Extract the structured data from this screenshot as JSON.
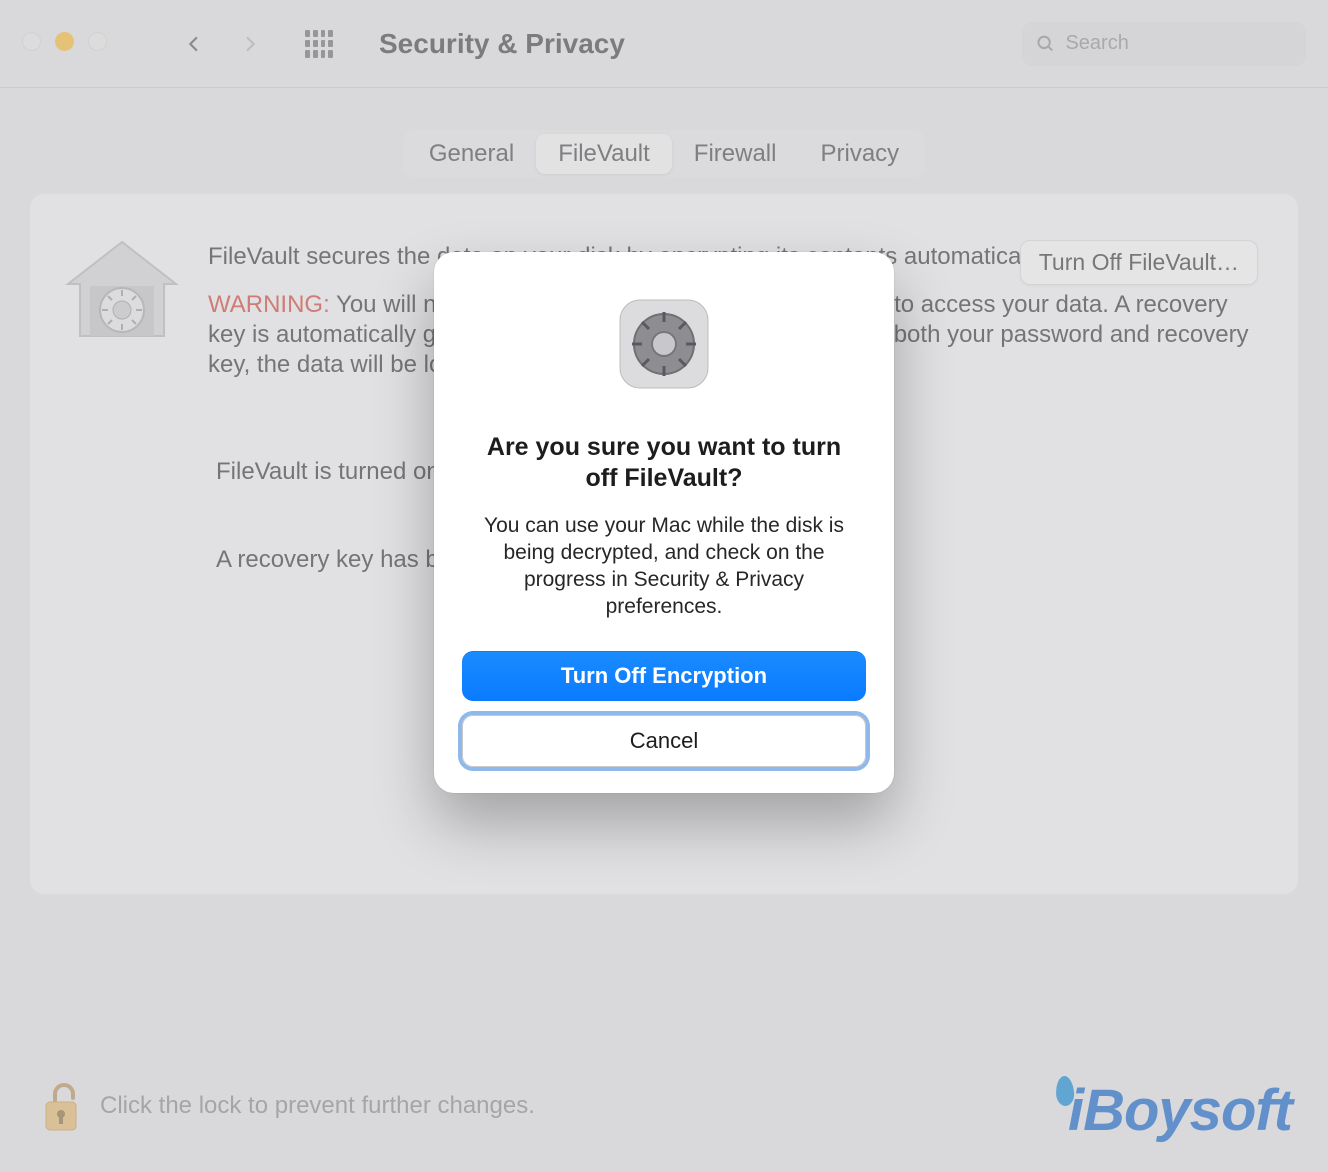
{
  "header": {
    "title": "Security & Privacy",
    "search_placeholder": "Search"
  },
  "tabs": {
    "items": [
      "General",
      "FileVault",
      "Firewall",
      "Privacy"
    ],
    "active_index": 1
  },
  "panel": {
    "description": "FileVault secures the data on your disk by encrypting its contents automatically.",
    "warning_label": "WARNING:",
    "warning_text": "You will need your login password or a recovery key to access your data. A recovery key is automatically generated as part of this setup. If you forget both your password and recovery key, the data will be lost.",
    "turn_off_button": "Turn Off FileVault…",
    "status_line": "FileVault is turned on for the disk \"Macintosh HD\".",
    "recovery_line": "A recovery key has been set."
  },
  "footer": {
    "lock_text": "Click the lock to prevent further changes."
  },
  "modal": {
    "heading": "Are you sure you want to turn off FileVault?",
    "body": "You can use your Mac while the disk is being decrypted, and check on the progress in Security & Privacy preferences.",
    "primary_label": "Turn Off Encryption",
    "secondary_label": "Cancel"
  },
  "watermark": "iBoysoft"
}
